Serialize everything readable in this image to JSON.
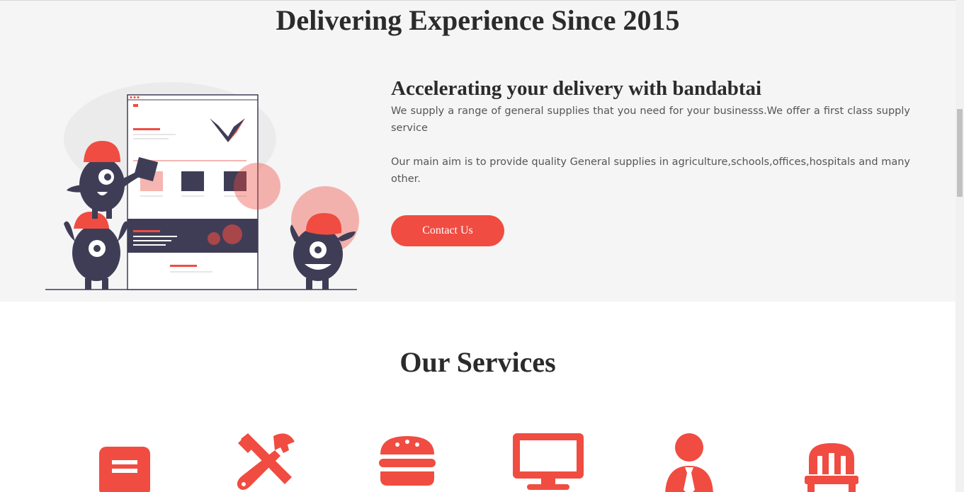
{
  "hero": {
    "headline": "Delivering Experience Since 2015"
  },
  "about": {
    "title": "Accelerating your delivery with bandabtai",
    "paragraph1": "We supply a range of general supplies that you need for your businesss.We offer a first class supply service",
    "paragraph2": "Our main aim is to provide quality General supplies in agriculture,schools,offices,hospitals and many other.",
    "contact_button": "Contact Us"
  },
  "services": {
    "title": "Our Services",
    "icons": [
      "stationery-icon",
      "tools-icon",
      "burger-icon",
      "monitor-icon",
      "user-tie-icon",
      "chair-icon"
    ]
  },
  "colors": {
    "accent": "#f04c41",
    "dark": "#2f2e41",
    "section_bg": "#f5f5f5"
  }
}
